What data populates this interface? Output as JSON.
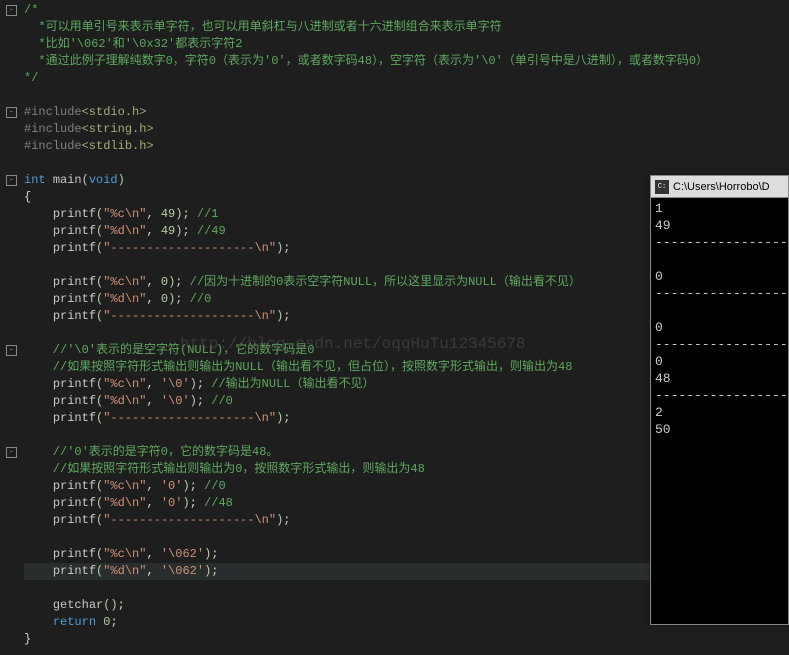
{
  "editor": {
    "lines": [
      {
        "type": "comment",
        "text": "/*",
        "fold": "box"
      },
      {
        "type": "comment",
        "text": "  *可以用单引号来表示单字符，也可以用单斜杠与八进制或者十六进制组合来表示单字符"
      },
      {
        "type": "comment",
        "text": "  *比如'\\062'和'\\0x32'都表示字符2"
      },
      {
        "type": "comment",
        "text": "  *通过此例子理解纯数字0，字符0（表示为'0'，或者数字码48），空字符（表示为'\\0'（单引号中是八进制），或者数字码0）"
      },
      {
        "type": "comment",
        "text": "*/"
      },
      {
        "type": "blank",
        "text": ""
      },
      {
        "type": "pp",
        "text": "#include<stdio.h>",
        "fold": "box"
      },
      {
        "type": "pp",
        "text": "#include<string.h>"
      },
      {
        "type": "pp",
        "text": "#include<stdlib.h>"
      },
      {
        "type": "blank",
        "text": ""
      },
      {
        "type": "sig",
        "kw": "int",
        "fn": "main",
        "args": "void",
        "fold": "box"
      },
      {
        "type": "brace",
        "text": "{"
      },
      {
        "type": "printf",
        "fmt": "\"%c\\n\"",
        "arg": "49",
        "comment": "//1"
      },
      {
        "type": "printf",
        "fmt": "\"%d\\n\"",
        "arg": "49",
        "comment": "//49"
      },
      {
        "type": "printf",
        "fmt": "\"--------------------\\n\""
      },
      {
        "type": "blank",
        "text": ""
      },
      {
        "type": "printf",
        "fmt": "\"%c\\n\"",
        "arg": "0",
        "comment": "//因为十进制的0表示空字符NULL，所以这里显示为NULL（输出看不见）"
      },
      {
        "type": "printf",
        "fmt": "\"%d\\n\"",
        "arg": "0",
        "comment": "//0"
      },
      {
        "type": "printf",
        "fmt": "\"--------------------\\n\""
      },
      {
        "type": "blank",
        "text": ""
      },
      {
        "type": "comment",
        "text": "    //'\\0'表示的是空字符(NULL)，它的数字码是0",
        "fold": "box"
      },
      {
        "type": "comment",
        "text": "    //如果按照字符形式输出则输出为NULL（输出看不见，但占位），按照数字形式输出，则输出为48"
      },
      {
        "type": "printf",
        "fmt": "\"%c\\n\"",
        "arg": "'\\0'",
        "comment": "//输出为NULL（输出看不见）"
      },
      {
        "type": "printf",
        "fmt": "\"%d\\n\"",
        "arg": "'\\0'",
        "comment": "//0"
      },
      {
        "type": "printf",
        "fmt": "\"--------------------\\n\""
      },
      {
        "type": "blank",
        "text": ""
      },
      {
        "type": "comment",
        "text": "    //'0'表示的是字符0，它的数字码是48。",
        "fold": "box"
      },
      {
        "type": "comment",
        "text": "    //如果按照字符形式输出则输出为0，按照数字形式输出，则输出为48"
      },
      {
        "type": "printf",
        "fmt": "\"%c\\n\"",
        "arg": "'0'",
        "comment": "//0"
      },
      {
        "type": "printf",
        "fmt": "\"%d\\n\"",
        "arg": "'0'",
        "comment": "//48"
      },
      {
        "type": "printf",
        "fmt": "\"--------------------\\n\""
      },
      {
        "type": "blank",
        "text": ""
      },
      {
        "type": "printf",
        "fmt": "\"%c\\n\"",
        "arg": "'\\062'"
      },
      {
        "type": "printf",
        "fmt": "\"%d\\n\"",
        "arg": "'\\062'",
        "hl": true
      },
      {
        "type": "blank",
        "text": ""
      },
      {
        "type": "call",
        "fn": "getchar"
      },
      {
        "type": "ret",
        "kw": "return",
        "val": "0"
      },
      {
        "type": "brace",
        "text": "}"
      }
    ]
  },
  "console": {
    "title": "C:\\Users\\Horrobo\\D",
    "output": "1\n49\n--------------------\n\n0\n--------------------\n\n0\n--------------------\n0\n48\n--------------------\n2\n50\n"
  },
  "watermark": "http://blog.csdn.net/oqqHuTu12345678"
}
